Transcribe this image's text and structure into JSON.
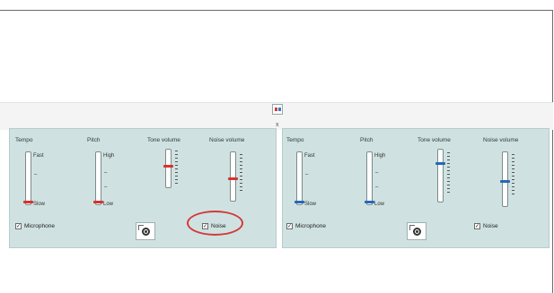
{
  "left_panel": {
    "columns": {
      "tempo": "Tempo",
      "pitch": "Pitch",
      "tone_volume": "Tone volume",
      "noise_volume": "Noise volume"
    },
    "tempo": {
      "top": "Fast",
      "mid": "–",
      "bottom": "Slow",
      "level": 0.0
    },
    "pitch": {
      "top": "High",
      "mid1": "–",
      "mid2": "–",
      "bottom": "Low",
      "level": 0.0
    },
    "tone_volume": {
      "level": 0.55
    },
    "noise_volume": {
      "level": 0.45
    },
    "microphone_label": "Microphone",
    "microphone_checked": true,
    "noise_label": "Noise",
    "noise_checked": true,
    "thumb_color": "#d8322e"
  },
  "right_panel": {
    "columns": {
      "tempo": "Tempo",
      "pitch": "Pitch",
      "tone_volume": "Tone volume",
      "noise_volume": "Noise volume"
    },
    "tempo": {
      "top": "Fast",
      "mid": "–",
      "bottom": "Slow",
      "level": 0.0
    },
    "pitch": {
      "top": "High",
      "mid1": "–",
      "mid2": "–",
      "bottom": "Low",
      "level": 0.0
    },
    "tone_volume": {
      "level": 0.75
    },
    "noise_volume": {
      "level": 0.45
    },
    "microphone_label": "Microphone",
    "microphone_checked": true,
    "noise_label": "Noise",
    "noise_checked": true,
    "thumb_color": "#2668b8"
  },
  "divider_glyph": "x",
  "check_glyph": "✓",
  "icons": [
    "settings-gear-icon",
    "swap-icon",
    "checkbox-icon"
  ],
  "highlight_color": "#d33a3a"
}
